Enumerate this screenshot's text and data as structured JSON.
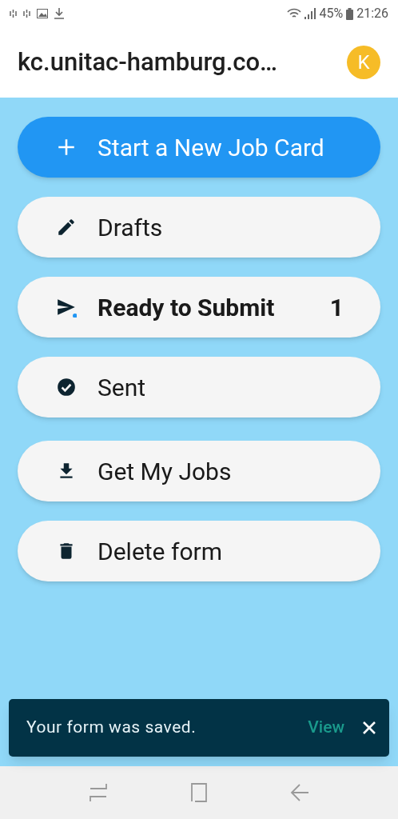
{
  "status_bar": {
    "battery": "45%",
    "time": "21:26"
  },
  "header": {
    "title": "kc.unitac-hamburg.co…",
    "avatar": "K"
  },
  "menu": [
    {
      "kind": "primary",
      "label": "Start a New Job Card",
      "unread": false
    },
    {
      "kind": "secondary",
      "label": "Drafts",
      "unread": false
    },
    {
      "kind": "secondary",
      "label": "Ready to Submit",
      "unread": true,
      "count": "1"
    },
    {
      "kind": "secondary",
      "label": "Sent",
      "unread": false
    },
    {
      "kind": "secondary",
      "label": "Get My Jobs",
      "unread": false
    },
    {
      "kind": "secondary",
      "label": "Delete form",
      "unread": false
    }
  ],
  "snackbar": {
    "message": "Your form was saved.",
    "action": "View"
  }
}
